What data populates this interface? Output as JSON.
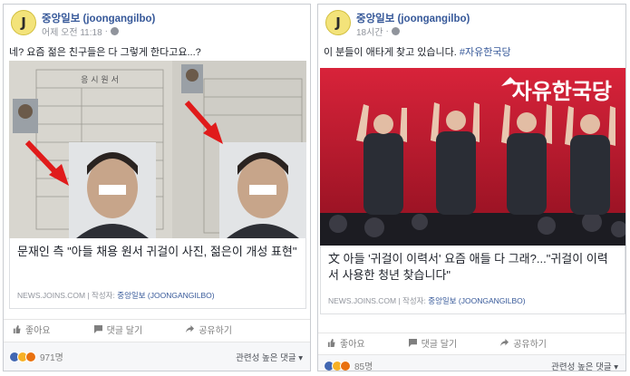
{
  "left_post": {
    "page_name": "중앙일보 (joongangilbo)",
    "timestamp": "어제 오전 11:18",
    "avatar_letter": "J",
    "text": "네? 요즘 젊은 친구들은 다 그렇게 한다고요...?",
    "image_form_title": "응 시 원 서",
    "link_title": "문재인 측 \"아들 채용 원서 귀걸이 사진, 젊은이 개성 표현\"",
    "link_domain": "NEWS.JOINS.COM",
    "link_author_label": "작성자:",
    "link_author": "중앙일보 (JOONGANGILBO)",
    "actions": [
      "좋아요",
      "댓글 달기",
      "공유하기"
    ],
    "reaction_count": "971명",
    "sort_label": "관련성 높은 댓글"
  },
  "right_post": {
    "page_name": "중앙일보 (joongangilbo)",
    "timestamp": "18시간",
    "avatar_letter": "J",
    "text": "이 분들이 애타게 찾고 있습니다.",
    "hashtag": "#자유한국당",
    "banner_text": "자유한국당",
    "link_title": "文 아들 '귀걸이 이력서' 요즘 애들 다 그래?...\"귀걸이 이력서 사용한 청년 찾습니다\"",
    "link_domain": "NEWS.JOINS.COM",
    "link_author_label": "작성자:",
    "link_author": "중앙일보 (JOONGANGILBO)",
    "actions": [
      "좋아요",
      "댓글 달기",
      "공유하기"
    ],
    "reaction_count": "85명",
    "sort_label": "관련성 높은 댓글"
  },
  "colors": {
    "link_blue": "#365899",
    "meta_gray": "#90949c",
    "party_red": "#c81e2d",
    "arrow_red": "#e01b1b"
  },
  "icons": [
    "like-icon",
    "comment-icon",
    "share-icon",
    "globe-icon",
    "dropdown-caret-icon"
  ]
}
